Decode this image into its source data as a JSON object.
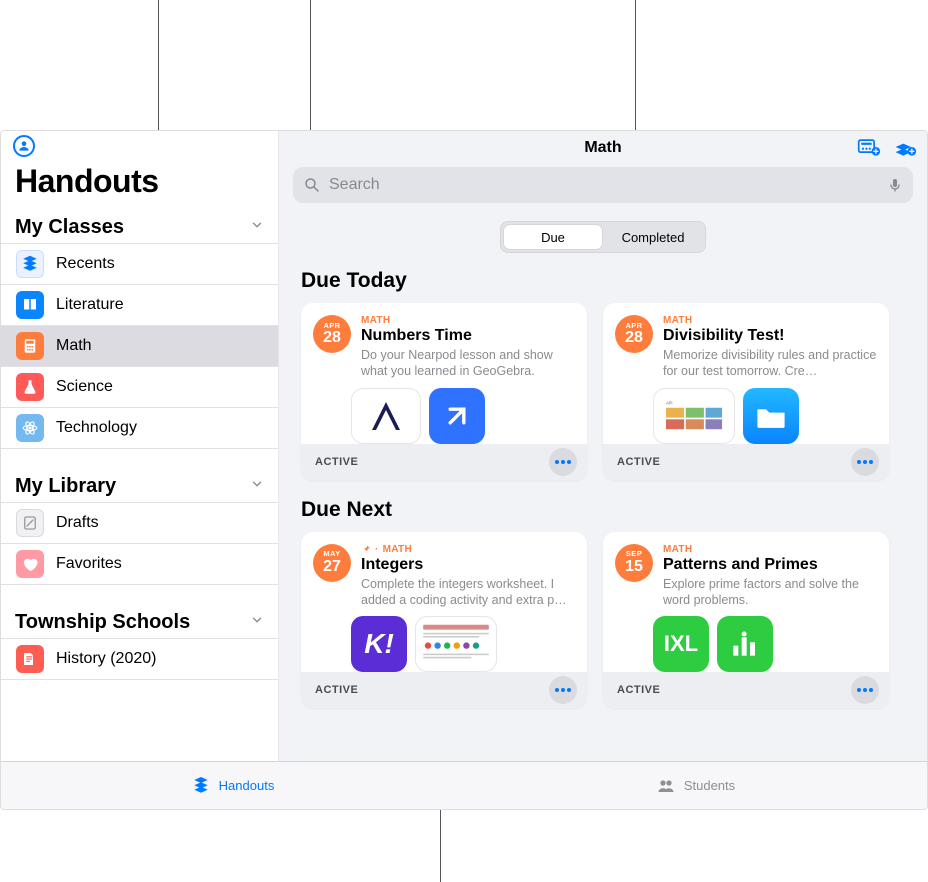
{
  "sidebar": {
    "title": "Handouts",
    "sections": [
      {
        "header": "My Classes",
        "items": [
          {
            "label": "Recents",
            "icon": "recents"
          },
          {
            "label": "Literature",
            "icon": "book"
          },
          {
            "label": "Math",
            "icon": "calculator",
            "selected": true
          },
          {
            "label": "Science",
            "icon": "flask"
          },
          {
            "label": "Technology",
            "icon": "atom"
          }
        ]
      },
      {
        "header": "My Library",
        "items": [
          {
            "label": "Drafts",
            "icon": "draft"
          },
          {
            "label": "Favorites",
            "icon": "heart"
          }
        ]
      },
      {
        "header": "Township Schools",
        "items": [
          {
            "label": "History (2020)",
            "icon": "history"
          }
        ]
      }
    ]
  },
  "header": {
    "title": "Math"
  },
  "search": {
    "placeholder": "Search"
  },
  "segments": {
    "due": "Due",
    "completed": "Completed"
  },
  "sections": {
    "dueToday": {
      "title": "Due Today",
      "cards": [
        {
          "month": "APR",
          "day": "28",
          "subject": "MATH",
          "title": "Numbers Time",
          "desc": "Do your Nearpod lesson and show what you learned in GeoGebra.",
          "status": "ACTIVE"
        },
        {
          "month": "APR",
          "day": "28",
          "subject": "MATH",
          "title": "Divisibility Test!",
          "desc": "Memorize divisibility rules and practice for our test tomorrow. Cre…",
          "status": "ACTIVE"
        }
      ]
    },
    "dueNext": {
      "title": "Due Next",
      "cards": [
        {
          "month": "MAY",
          "day": "27",
          "subject": "MATH",
          "pinned": true,
          "title": "Integers",
          "desc": "Complete the integers worksheet. I added a coding activity and extra p…",
          "status": "ACTIVE"
        },
        {
          "month": "SEP",
          "day": "15",
          "subject": "MATH",
          "title": "Patterns and Primes",
          "desc": "Explore prime factors and solve the word problems.",
          "status": "ACTIVE"
        }
      ]
    }
  },
  "tabbar": {
    "handouts": "Handouts",
    "students": "Students"
  }
}
